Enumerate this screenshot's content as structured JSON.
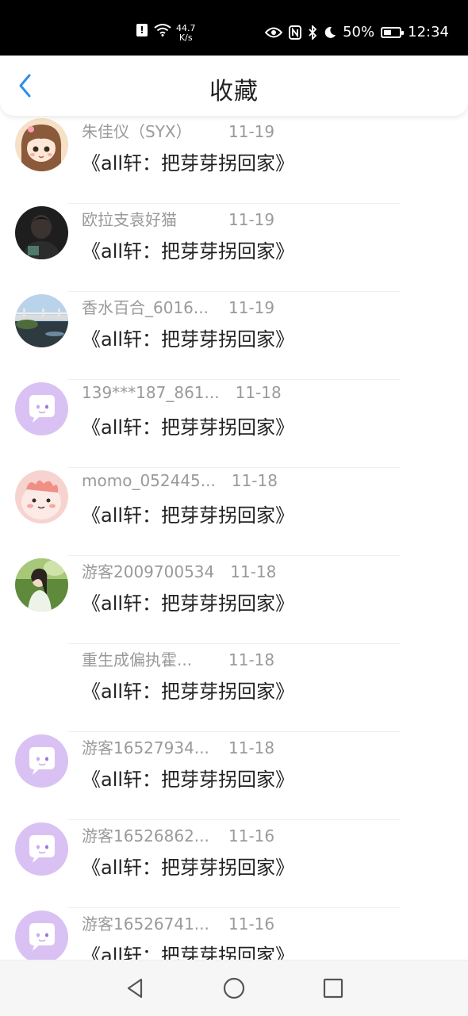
{
  "status_bar": {
    "net_speed_value": "44.7",
    "net_speed_unit": "K/s",
    "battery": "50%",
    "time": "12:34",
    "icons": [
      "alert-icon",
      "wifi-icon",
      "eye-icon",
      "nfc-icon",
      "bluetooth-icon",
      "moon-icon",
      "battery-icon"
    ]
  },
  "header": {
    "title": "收藏",
    "back_icon": "chevron-left-icon"
  },
  "items": [
    {
      "name": "朱佳仪（SYX）",
      "date": "11-19",
      "story": "《all轩：把芽芽拐回家》",
      "avatar": "cartoon-girl"
    },
    {
      "name": "欧拉支袁好猫",
      "date": "11-19",
      "story": "《all轩：把芽芽拐回家》",
      "avatar": "photo-person-dark"
    },
    {
      "name": "香水百合_6016...",
      "date": "11-19",
      "story": "《all轩：把芽芽拐回家》",
      "avatar": "photo-bridge"
    },
    {
      "name": "139***187_861...",
      "date": "11-18",
      "story": "《all轩：把芽芽拐回家》",
      "avatar": "default-chat"
    },
    {
      "name": "momo_052445...",
      "date": "11-18",
      "story": "《all轩：把芽芽拐回家》",
      "avatar": "cartoon-pink"
    },
    {
      "name": "游客2009700534",
      "date": "11-18",
      "story": "《all轩：把芽芽拐回家》",
      "avatar": "photo-girl-field"
    },
    {
      "name": "重生成偏执霍...",
      "date": "11-18",
      "story": "《all轩：把芽芽拐回家》",
      "avatar": "none"
    },
    {
      "name": "游客16527934...",
      "date": "11-18",
      "story": "《all轩：把芽芽拐回家》",
      "avatar": "default-chat"
    },
    {
      "name": "游客16526862...",
      "date": "11-16",
      "story": "《all轩：把芽芽拐回家》",
      "avatar": "default-chat"
    },
    {
      "name": "游客16526741...",
      "date": "11-16",
      "story": "《all轩：把芽芽拐回家》",
      "avatar": "default-chat"
    }
  ],
  "nav": {
    "back": "triangle-back-icon",
    "home": "circle-home-icon",
    "recents": "square-recents-icon"
  },
  "colors": {
    "accent": "#2f8fe8",
    "default_avatar_bg": "#d9c2f3",
    "name_text": "#9a9a9a",
    "story_text": "#222222"
  }
}
